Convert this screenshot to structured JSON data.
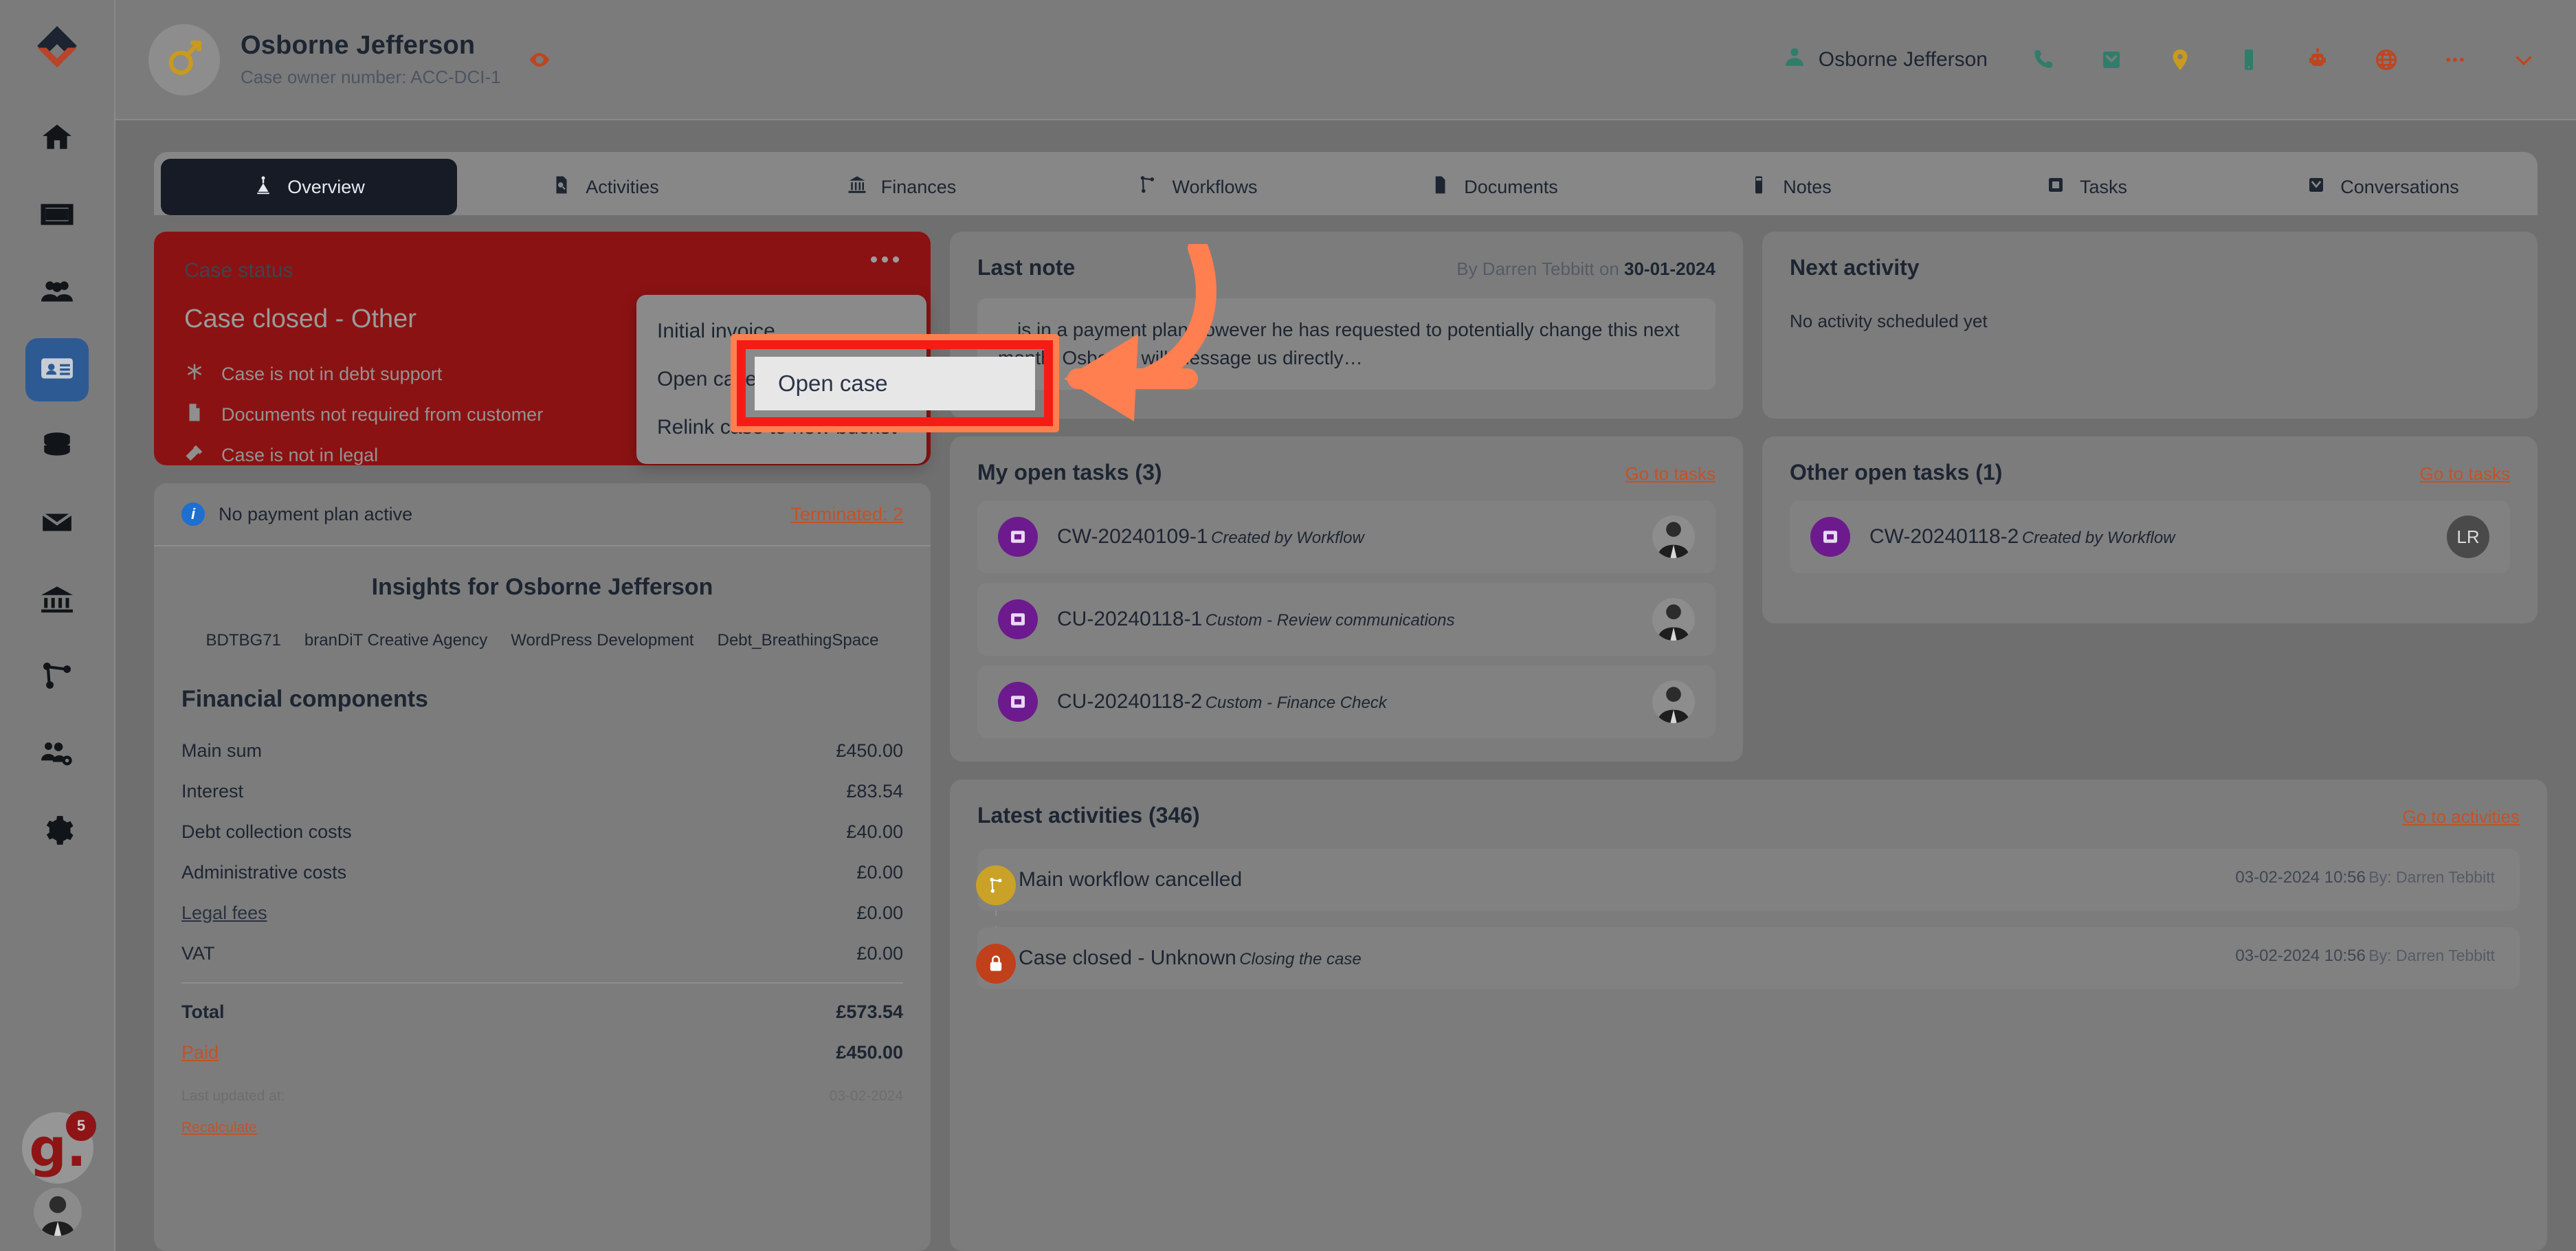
{
  "header": {
    "customer_name": "Osborne Jefferson",
    "case_owner_line": "Case owner number: ACC-DCI-1",
    "gender_icon": "male-icon",
    "eye_icon": "eye-icon",
    "account_user": "Osborne Jefferson",
    "icons": [
      {
        "name": "phone-icon",
        "color": "#2f7d6a"
      },
      {
        "name": "envelope-icon",
        "color": "#2f7d6a"
      },
      {
        "name": "map-pin-icon",
        "color": "#c99a1e"
      },
      {
        "name": "mobile-icon",
        "color": "#2f7d6a"
      },
      {
        "name": "robot-icon",
        "color": "#c0441f"
      },
      {
        "name": "globe-icon",
        "color": "#c0441f"
      },
      {
        "name": "ellipsis-icon",
        "color": "#c0441f"
      },
      {
        "name": "chevron-down-icon",
        "color": "#c0441f"
      }
    ]
  },
  "rail": {
    "logo": "brand-logo",
    "items": [
      {
        "name": "home-icon",
        "active": false
      },
      {
        "name": "card-icon",
        "active": false
      },
      {
        "name": "people-icon",
        "active": false
      },
      {
        "name": "contact-card-icon",
        "active": true
      },
      {
        "name": "database-icon",
        "active": false
      },
      {
        "name": "mail-icon",
        "active": false
      },
      {
        "name": "bank-icon",
        "active": false
      },
      {
        "name": "workflow-icon",
        "active": false
      },
      {
        "name": "team-settings-icon",
        "active": false
      },
      {
        "name": "gear-icon",
        "active": false
      }
    ],
    "badge_letter": "g.",
    "badge_count": "5"
  },
  "tabs": [
    {
      "label": "Overview",
      "icon": "overview-icon",
      "active": true
    },
    {
      "label": "Activities",
      "icon": "activities-icon",
      "active": false
    },
    {
      "label": "Finances",
      "icon": "finances-icon",
      "active": false
    },
    {
      "label": "Workflows",
      "icon": "workflows-icon",
      "active": false
    },
    {
      "label": "Documents",
      "icon": "documents-icon",
      "active": false
    },
    {
      "label": "Notes",
      "icon": "notes-icon",
      "active": false
    },
    {
      "label": "Tasks",
      "icon": "tasks-icon",
      "active": false
    },
    {
      "label": "Conversations",
      "icon": "conversations-icon",
      "active": false
    }
  ],
  "status_card": {
    "label": "Case status",
    "value": "Case closed - Other",
    "flags": [
      {
        "icon": "asterisk-icon",
        "text": "Case is not in debt support"
      },
      {
        "icon": "document-icon",
        "text": "Documents not required from customer"
      },
      {
        "icon": "gavel-icon",
        "text": "Case is not in legal"
      }
    ],
    "menu_icon": "ellipsis-icon",
    "menu_items": [
      "Initial invoice",
      "Open case",
      "Relink case to new bucket"
    ],
    "highlighted_item": "Open case"
  },
  "payment_bar": {
    "text": "No payment plan active",
    "terminated_link": "Terminated: 2",
    "info_icon": "info-icon"
  },
  "insights": {
    "title": "Insights for Osborne Jefferson",
    "tags": [
      "BDTBG71",
      "branDiT Creative Agency",
      "WordPress Development",
      "Debt_BreathingSpace"
    ],
    "financial_title": "Financial components",
    "rows": [
      {
        "label": "Main sum",
        "value": "£450.00",
        "link": false
      },
      {
        "label": "Interest",
        "value": "£83.54",
        "link": false
      },
      {
        "label": "Debt collection costs",
        "value": "£40.00",
        "link": false
      },
      {
        "label": "Administrative costs",
        "value": "£0.00",
        "link": false
      },
      {
        "label": "Legal fees",
        "value": "£0.00",
        "link": true
      },
      {
        "label": "VAT",
        "value": "£0.00",
        "link": false
      }
    ],
    "total_label": "Total",
    "total_value": "£573.54",
    "paid_label": "Paid",
    "paid_value": "£450.00",
    "last_updated_label": "Last updated at:",
    "last_updated_value": "03-02-2024",
    "recalculate": "Recalculate"
  },
  "last_note": {
    "title": "Last note",
    "meta_prefix": "By Darren Tebbitt on ",
    "meta_date": "30-01-2024",
    "body": "…is in a payment plan however he has requested to potentially change this next month. Osborne will message us directly…"
  },
  "next_activity": {
    "title": "Next activity",
    "empty": "No activity scheduled yet"
  },
  "my_open_tasks": {
    "title": "My open tasks (3)",
    "link": "Go to tasks",
    "items": [
      {
        "id": "CW-20240109-1",
        "sub": "Created by Workflow",
        "avatar": "photo",
        "initials": ""
      },
      {
        "id": "CU-20240118-1",
        "sub": "Custom - Review communications",
        "avatar": "photo",
        "initials": ""
      },
      {
        "id": "CU-20240118-2",
        "sub": "Custom - Finance Check",
        "avatar": "photo",
        "initials": ""
      }
    ]
  },
  "other_open_tasks": {
    "title": "Other open tasks (1)",
    "link": "Go to tasks",
    "items": [
      {
        "id": "CW-20240118-2",
        "sub": "Created by Workflow",
        "avatar": "initials",
        "initials": "LR"
      }
    ]
  },
  "latest_activities": {
    "title": "Latest activities (346)",
    "link": "Go to activities",
    "items": [
      {
        "title": "Main workflow cancelled",
        "sub": "",
        "date": "03-02-2024 10:56",
        "by": "By: Darren Tebbitt",
        "icon": "workflow-icon",
        "tone": "wf"
      },
      {
        "title": "Case closed - Unknown",
        "sub": "Closing the case",
        "date": "03-02-2024 10:56",
        "by": "By: Darren Tebbitt",
        "icon": "lock-icon",
        "tone": "cl"
      }
    ]
  },
  "colors": {
    "status_red": "#8b1212",
    "accent_orange": "#c35228",
    "highlight_outer": "#ff7f50",
    "highlight_inner": "#f41d16",
    "active_tab": "#161b26",
    "rail_active": "#2d5a93",
    "task_purple": "#6c1a8e"
  }
}
